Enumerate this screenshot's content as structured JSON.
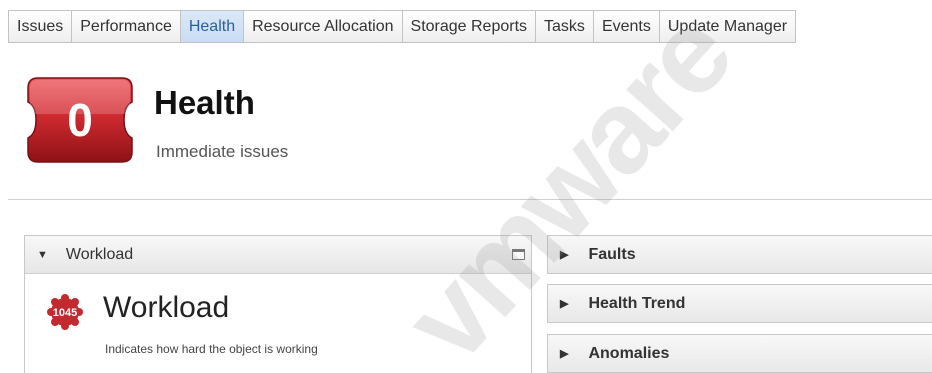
{
  "tabs": [
    {
      "label": "Issues",
      "active": false
    },
    {
      "label": "Performance",
      "active": false
    },
    {
      "label": "Health",
      "active": true
    },
    {
      "label": "Resource Allocation",
      "active": false
    },
    {
      "label": "Storage Reports",
      "active": false
    },
    {
      "label": "Tasks",
      "active": false
    },
    {
      "label": "Events",
      "active": false
    },
    {
      "label": "Update Manager",
      "active": false
    }
  ],
  "health": {
    "score": "0",
    "title": "Health",
    "subtitle": "Immediate issues",
    "badge_color": "#c8242b"
  },
  "workload_panel": {
    "header": "Workload",
    "title": "Workload",
    "badge_value": "1045",
    "description": "Indicates how hard the object is working"
  },
  "side_panels": {
    "faults": "Faults",
    "health_trend": "Health Trend",
    "anomalies": "Anomalies"
  },
  "watermark": "vmware",
  "icons": {
    "maximize": "maximize-icon",
    "expand": "caret-down-icon",
    "collapse": "caret-right-icon"
  }
}
